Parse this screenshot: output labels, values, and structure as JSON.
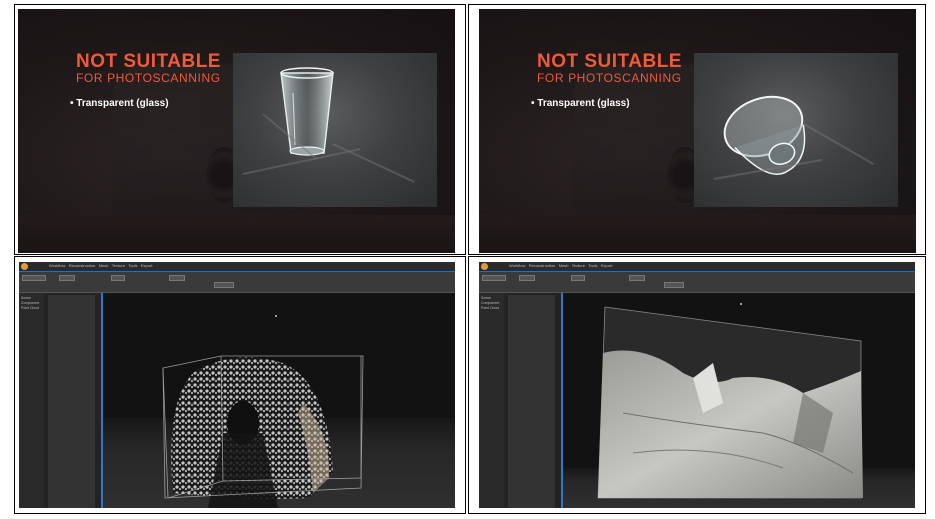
{
  "slides": [
    {
      "title": "NOT SUITABLE",
      "subtitle": "FOR PHOTOSCANNING",
      "bullet": "• Transparent (glass)",
      "photo": "glass-upright"
    },
    {
      "title": "NOT SUITABLE",
      "subtitle": "FOR PHOTOSCANNING",
      "bullet": "• Transparent (glass)",
      "photo": "glass-tilted"
    }
  ],
  "app": {
    "tabs": [
      "Workflow",
      "Reconstruction",
      "Mesh",
      "Texture",
      "Tools",
      "Export"
    ],
    "tree": [
      "Scene",
      "Component",
      "Point Cloud"
    ],
    "accent": "#2a78d0",
    "logo_color": "#e89a34"
  },
  "colors": {
    "title": "#f05a37",
    "bullet": "#ffffff"
  }
}
